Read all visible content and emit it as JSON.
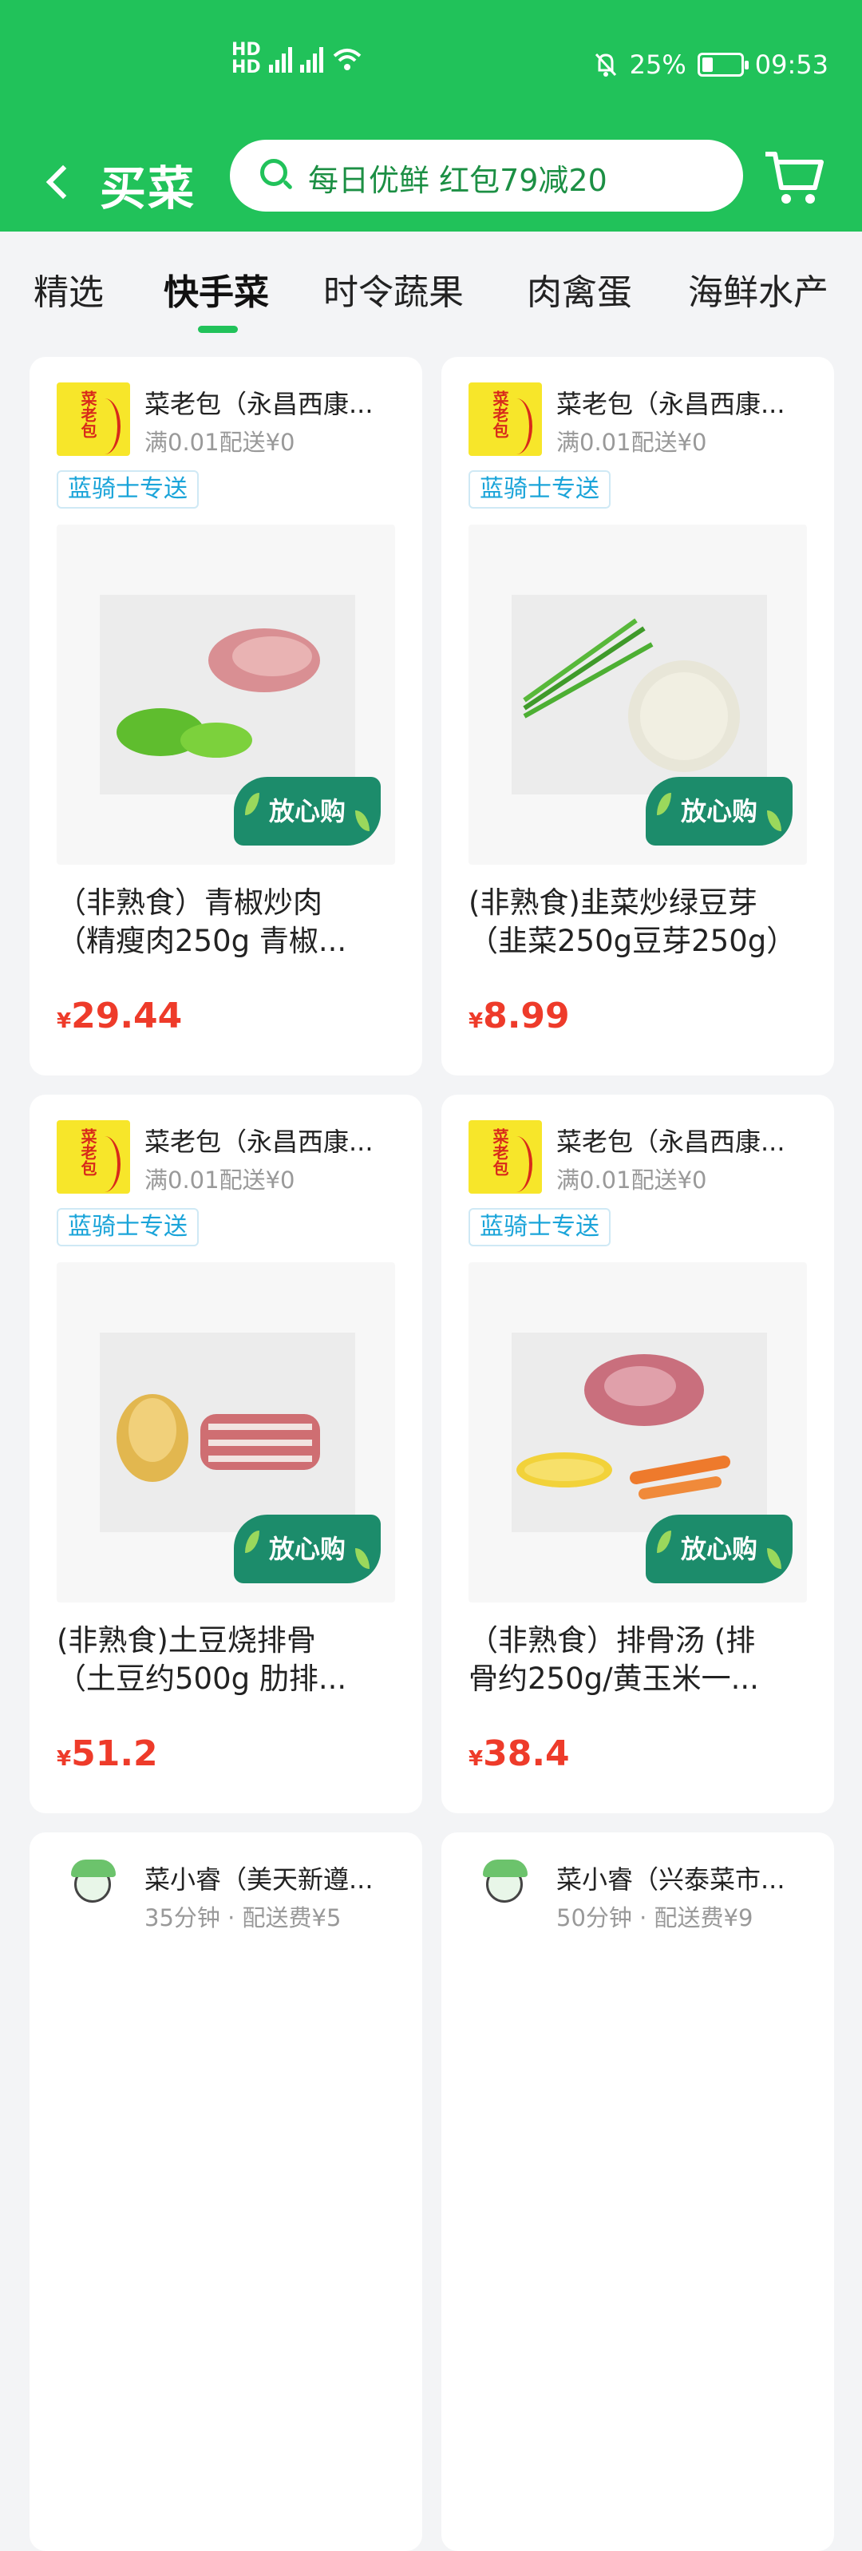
{
  "status_bar": {
    "network_left": "HD",
    "network_right": "HD",
    "battery": "25%",
    "battery_level": 0.25,
    "time": "09:53"
  },
  "header": {
    "title": "买菜",
    "search_placeholder": "每日优鲜 红包79减20"
  },
  "tabs": [
    {
      "label": "精选",
      "active": false
    },
    {
      "label": "快手菜",
      "active": true
    },
    {
      "label": "时令蔬果",
      "active": false
    },
    {
      "label": "肉禽蛋",
      "active": false
    },
    {
      "label": "海鲜水产",
      "active": false
    }
  ],
  "products": [
    {
      "shop_name": "菜老包（永昌西康...",
      "shop_sub": "满0.01配送¥0",
      "badge": "蓝骑士专送",
      "image_badge": "放心购",
      "name_line1": "（非熟食）青椒炒肉",
      "name_line2": "（精瘦肉250g 青椒...",
      "currency": "¥",
      "price": "29.44",
      "logo_text": "菜老包"
    },
    {
      "shop_name": "菜老包（永昌西康...",
      "shop_sub": "满0.01配送¥0",
      "badge": "蓝骑士专送",
      "image_badge": "放心购",
      "name_line1": "(非熟食)韭菜炒绿豆芽",
      "name_line2": "（韭菜250g豆芽250g）",
      "currency": "¥",
      "price": "8.99",
      "logo_text": "菜老包"
    },
    {
      "shop_name": "菜老包（永昌西康...",
      "shop_sub": "满0.01配送¥0",
      "badge": "蓝骑士专送",
      "image_badge": "放心购",
      "name_line1": "(非熟食)土豆烧排骨",
      "name_line2": "（土豆约500g 肋排...",
      "currency": "¥",
      "price": "51.2",
      "logo_text": "菜老包"
    },
    {
      "shop_name": "菜老包（永昌西康...",
      "shop_sub": "满0.01配送¥0",
      "badge": "蓝骑士专送",
      "image_badge": "放心购",
      "name_line1": "（非熟食）排骨汤 (排",
      "name_line2": "骨约250g/黄玉米一...",
      "currency": "¥",
      "price": "38.4",
      "logo_text": "菜老包"
    },
    {
      "shop_name": "菜小睿（美天新遵...",
      "shop_sub": "35分钟 · 配送费¥5"
    },
    {
      "shop_name": "菜小睿（兴泰菜市...",
      "shop_sub": "50分钟 · 配送费¥9"
    }
  ],
  "colors": {
    "brand_green": "#21c25a",
    "price_red": "#ee3b2a",
    "badge_blue": "#1aa4d9"
  },
  "icons": {
    "back": "chevron-left-icon",
    "search": "search-icon",
    "cart": "shopping-cart-icon"
  }
}
